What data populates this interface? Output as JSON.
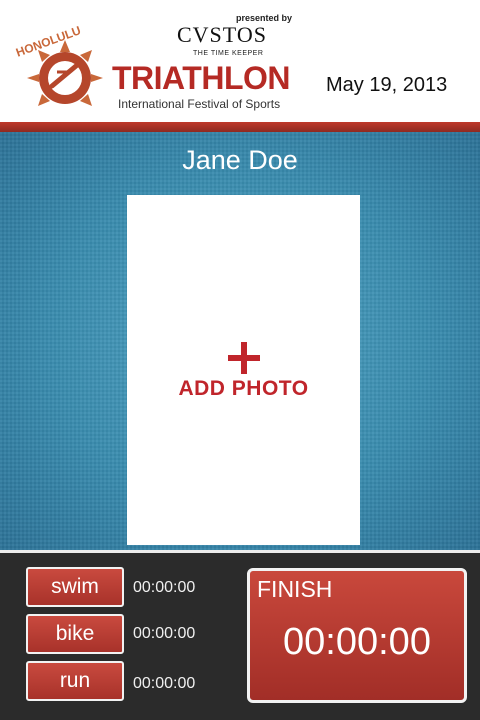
{
  "header": {
    "presented_by": "presented by",
    "sponsor": "CVSTOS",
    "sponsor_tagline": "THE TIME KEEPER",
    "emblem_text": "HONOLULU",
    "event_title": "TRIATHLON",
    "event_subtitle": "International Festival of Sports",
    "date": "May 19, 2013"
  },
  "runner": {
    "name": "Jane Doe"
  },
  "photo": {
    "icon": "plus-icon",
    "label": "ADD PHOTO"
  },
  "segments": [
    {
      "label": "swim",
      "time": "00:00:00"
    },
    {
      "label": "bike",
      "time": "00:00:00"
    },
    {
      "label": "run",
      "time": "00:00:00"
    }
  ],
  "finish": {
    "label": "FINISH",
    "time": "00:00:00"
  },
  "colors": {
    "brand_red": "#b52a24",
    "panel_blue": "#3a8db0",
    "dark_bg": "#2b2b2b"
  }
}
